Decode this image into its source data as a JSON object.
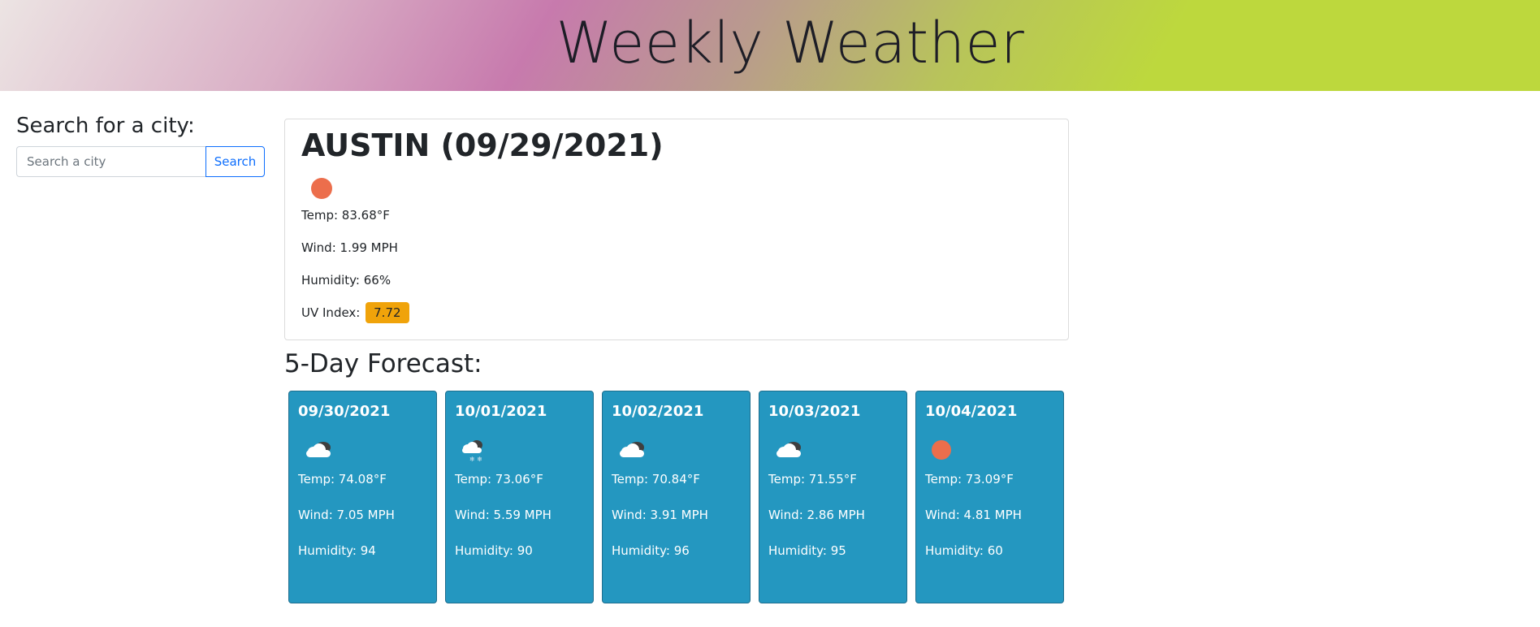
{
  "header": {
    "title": "Weekly Weather"
  },
  "search": {
    "heading": "Search for a city:",
    "placeholder": "Search a city",
    "button_label": "Search"
  },
  "current": {
    "title": "AUSTIN (09/29/2021)",
    "icon": "sun-icon",
    "temp": "Temp: 83.68°F",
    "wind": "Wind: 1.99 MPH",
    "humidity": "Humidity: 66%",
    "uv_label": "UV Index:",
    "uv_value": "7.72",
    "uv_color": "#f0a30a"
  },
  "forecast": {
    "heading": "5-Day Forecast:",
    "days": [
      {
        "date": "09/30/2021",
        "icon": "partly-cloudy-icon",
        "temp": "Temp: 74.08°F",
        "wind": "Wind: 7.05 MPH",
        "humidity": "Humidity: 94"
      },
      {
        "date": "10/01/2021",
        "icon": "rain-cloud-icon",
        "temp": "Temp: 73.06°F",
        "wind": "Wind: 5.59 MPH",
        "humidity": "Humidity: 90"
      },
      {
        "date": "10/02/2021",
        "icon": "partly-cloudy-icon",
        "temp": "Temp: 70.84°F",
        "wind": "Wind: 3.91 MPH",
        "humidity": "Humidity: 96"
      },
      {
        "date": "10/03/2021",
        "icon": "partly-cloudy-icon",
        "temp": "Temp: 71.55°F",
        "wind": "Wind: 2.86 MPH",
        "humidity": "Humidity: 95"
      },
      {
        "date": "10/04/2021",
        "icon": "sun-icon",
        "temp": "Temp: 73.09°F",
        "wind": "Wind: 4.81 MPH",
        "humidity": "Humidity: 60"
      }
    ]
  },
  "colors": {
    "card_bg": "#2497c0",
    "sun": "#ec6e4c",
    "button_accent": "#0d6efd"
  }
}
